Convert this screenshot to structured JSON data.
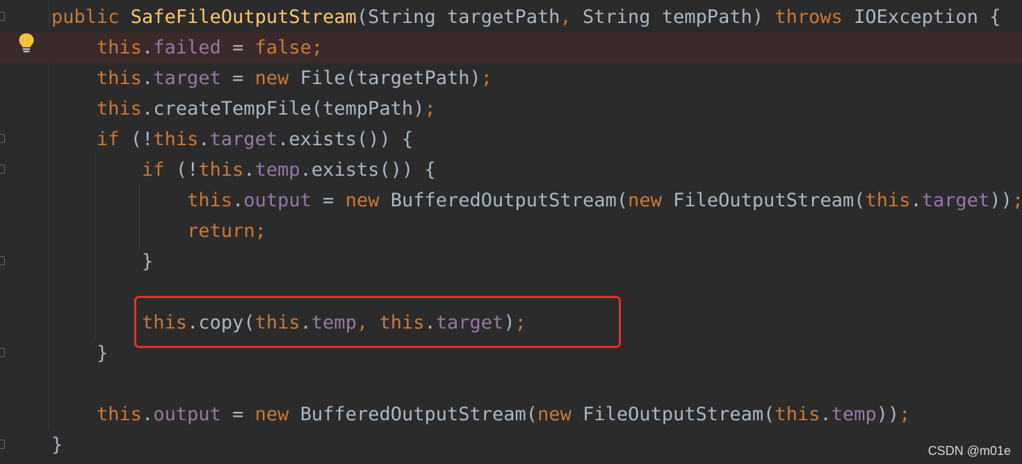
{
  "colors": {
    "background": "#2b2b2b",
    "keyword": "#cc7832",
    "method_declaration": "#ffc66d",
    "field": "#9876aa",
    "plain": "#a9b7c6",
    "highlighted_line": "#3b2a2a",
    "highlight_box": "#e2332b"
  },
  "gutter": {
    "intention_icon": "lightbulb-icon"
  },
  "watermark": "CSDN @m01e",
  "code_lines": [
    {
      "indent": "",
      "tokens": [
        {
          "t": "public ",
          "k": "kw"
        },
        {
          "t": "SafeFileOutputStream",
          "k": "fn"
        },
        {
          "t": "(String targetPath",
          "k": "plain"
        },
        {
          "t": ", ",
          "k": "kw"
        },
        {
          "t": "String tempPath) ",
          "k": "plain"
        },
        {
          "t": "throws ",
          "k": "kw"
        },
        {
          "t": "IOException {",
          "k": "plain"
        }
      ]
    },
    {
      "indent": "    ",
      "highlighted": true,
      "tokens": [
        {
          "t": "this",
          "k": "kw"
        },
        {
          "t": ".",
          "k": "plain"
        },
        {
          "t": "failed",
          "k": "field"
        },
        {
          "t": " = ",
          "k": "plain"
        },
        {
          "t": "false;",
          "k": "kw"
        }
      ]
    },
    {
      "indent": "    ",
      "tokens": [
        {
          "t": "this",
          "k": "kw"
        },
        {
          "t": ".",
          "k": "plain"
        },
        {
          "t": "target",
          "k": "field"
        },
        {
          "t": " = ",
          "k": "plain"
        },
        {
          "t": "new ",
          "k": "kw"
        },
        {
          "t": "File(targetPath)",
          "k": "plain"
        },
        {
          "t": ";",
          "k": "kw"
        }
      ]
    },
    {
      "indent": "    ",
      "tokens": [
        {
          "t": "this",
          "k": "kw"
        },
        {
          "t": ".createTempFile(tempPath)",
          "k": "plain"
        },
        {
          "t": ";",
          "k": "kw"
        }
      ]
    },
    {
      "indent": "    ",
      "tokens": [
        {
          "t": "if ",
          "k": "kw"
        },
        {
          "t": "(!",
          "k": "plain"
        },
        {
          "t": "this",
          "k": "kw"
        },
        {
          "t": ".",
          "k": "plain"
        },
        {
          "t": "target",
          "k": "field"
        },
        {
          "t": ".exists()) {",
          "k": "plain"
        }
      ]
    },
    {
      "indent": "        ",
      "tokens": [
        {
          "t": "if ",
          "k": "kw"
        },
        {
          "t": "(!",
          "k": "plain"
        },
        {
          "t": "this",
          "k": "kw"
        },
        {
          "t": ".",
          "k": "plain"
        },
        {
          "t": "temp",
          "k": "field"
        },
        {
          "t": ".exists()) {",
          "k": "plain"
        }
      ]
    },
    {
      "indent": "            ",
      "tokens": [
        {
          "t": "this",
          "k": "kw"
        },
        {
          "t": ".",
          "k": "plain"
        },
        {
          "t": "output",
          "k": "field"
        },
        {
          "t": " = ",
          "k": "plain"
        },
        {
          "t": "new ",
          "k": "kw"
        },
        {
          "t": "BufferedOutputStream(",
          "k": "plain"
        },
        {
          "t": "new ",
          "k": "kw"
        },
        {
          "t": "FileOutputStream(",
          "k": "plain"
        },
        {
          "t": "this",
          "k": "kw"
        },
        {
          "t": ".",
          "k": "plain"
        },
        {
          "t": "target",
          "k": "field"
        },
        {
          "t": "))",
          "k": "plain"
        },
        {
          "t": ";",
          "k": "kw"
        }
      ]
    },
    {
      "indent": "            ",
      "tokens": [
        {
          "t": "return;",
          "k": "kw"
        }
      ]
    },
    {
      "indent": "        ",
      "tokens": [
        {
          "t": "}",
          "k": "plain"
        }
      ]
    },
    {
      "indent": "",
      "tokens": []
    },
    {
      "indent": "        ",
      "tokens": [
        {
          "t": "this",
          "k": "kw"
        },
        {
          "t": ".copy(",
          "k": "plain"
        },
        {
          "t": "this",
          "k": "kw"
        },
        {
          "t": ".",
          "k": "plain"
        },
        {
          "t": "temp",
          "k": "field"
        },
        {
          "t": ", ",
          "k": "kw"
        },
        {
          "t": "this",
          "k": "kw"
        },
        {
          "t": ".",
          "k": "plain"
        },
        {
          "t": "target",
          "k": "field"
        },
        {
          "t": ")",
          "k": "plain"
        },
        {
          "t": ";",
          "k": "kw"
        }
      ]
    },
    {
      "indent": "    ",
      "tokens": [
        {
          "t": "}",
          "k": "plain"
        }
      ]
    },
    {
      "indent": "",
      "tokens": []
    },
    {
      "indent": "    ",
      "tokens": [
        {
          "t": "this",
          "k": "kw"
        },
        {
          "t": ".",
          "k": "plain"
        },
        {
          "t": "output",
          "k": "field"
        },
        {
          "t": " = ",
          "k": "plain"
        },
        {
          "t": "new ",
          "k": "kw"
        },
        {
          "t": "BufferedOutputStream(",
          "k": "plain"
        },
        {
          "t": "new ",
          "k": "kw"
        },
        {
          "t": "FileOutputStream(",
          "k": "plain"
        },
        {
          "t": "this",
          "k": "kw"
        },
        {
          "t": ".",
          "k": "plain"
        },
        {
          "t": "temp",
          "k": "field"
        },
        {
          "t": "))",
          "k": "plain"
        },
        {
          "t": ";",
          "k": "kw"
        }
      ]
    },
    {
      "indent": "",
      "tokens": [
        {
          "t": "}",
          "k": "plain"
        }
      ]
    }
  ]
}
